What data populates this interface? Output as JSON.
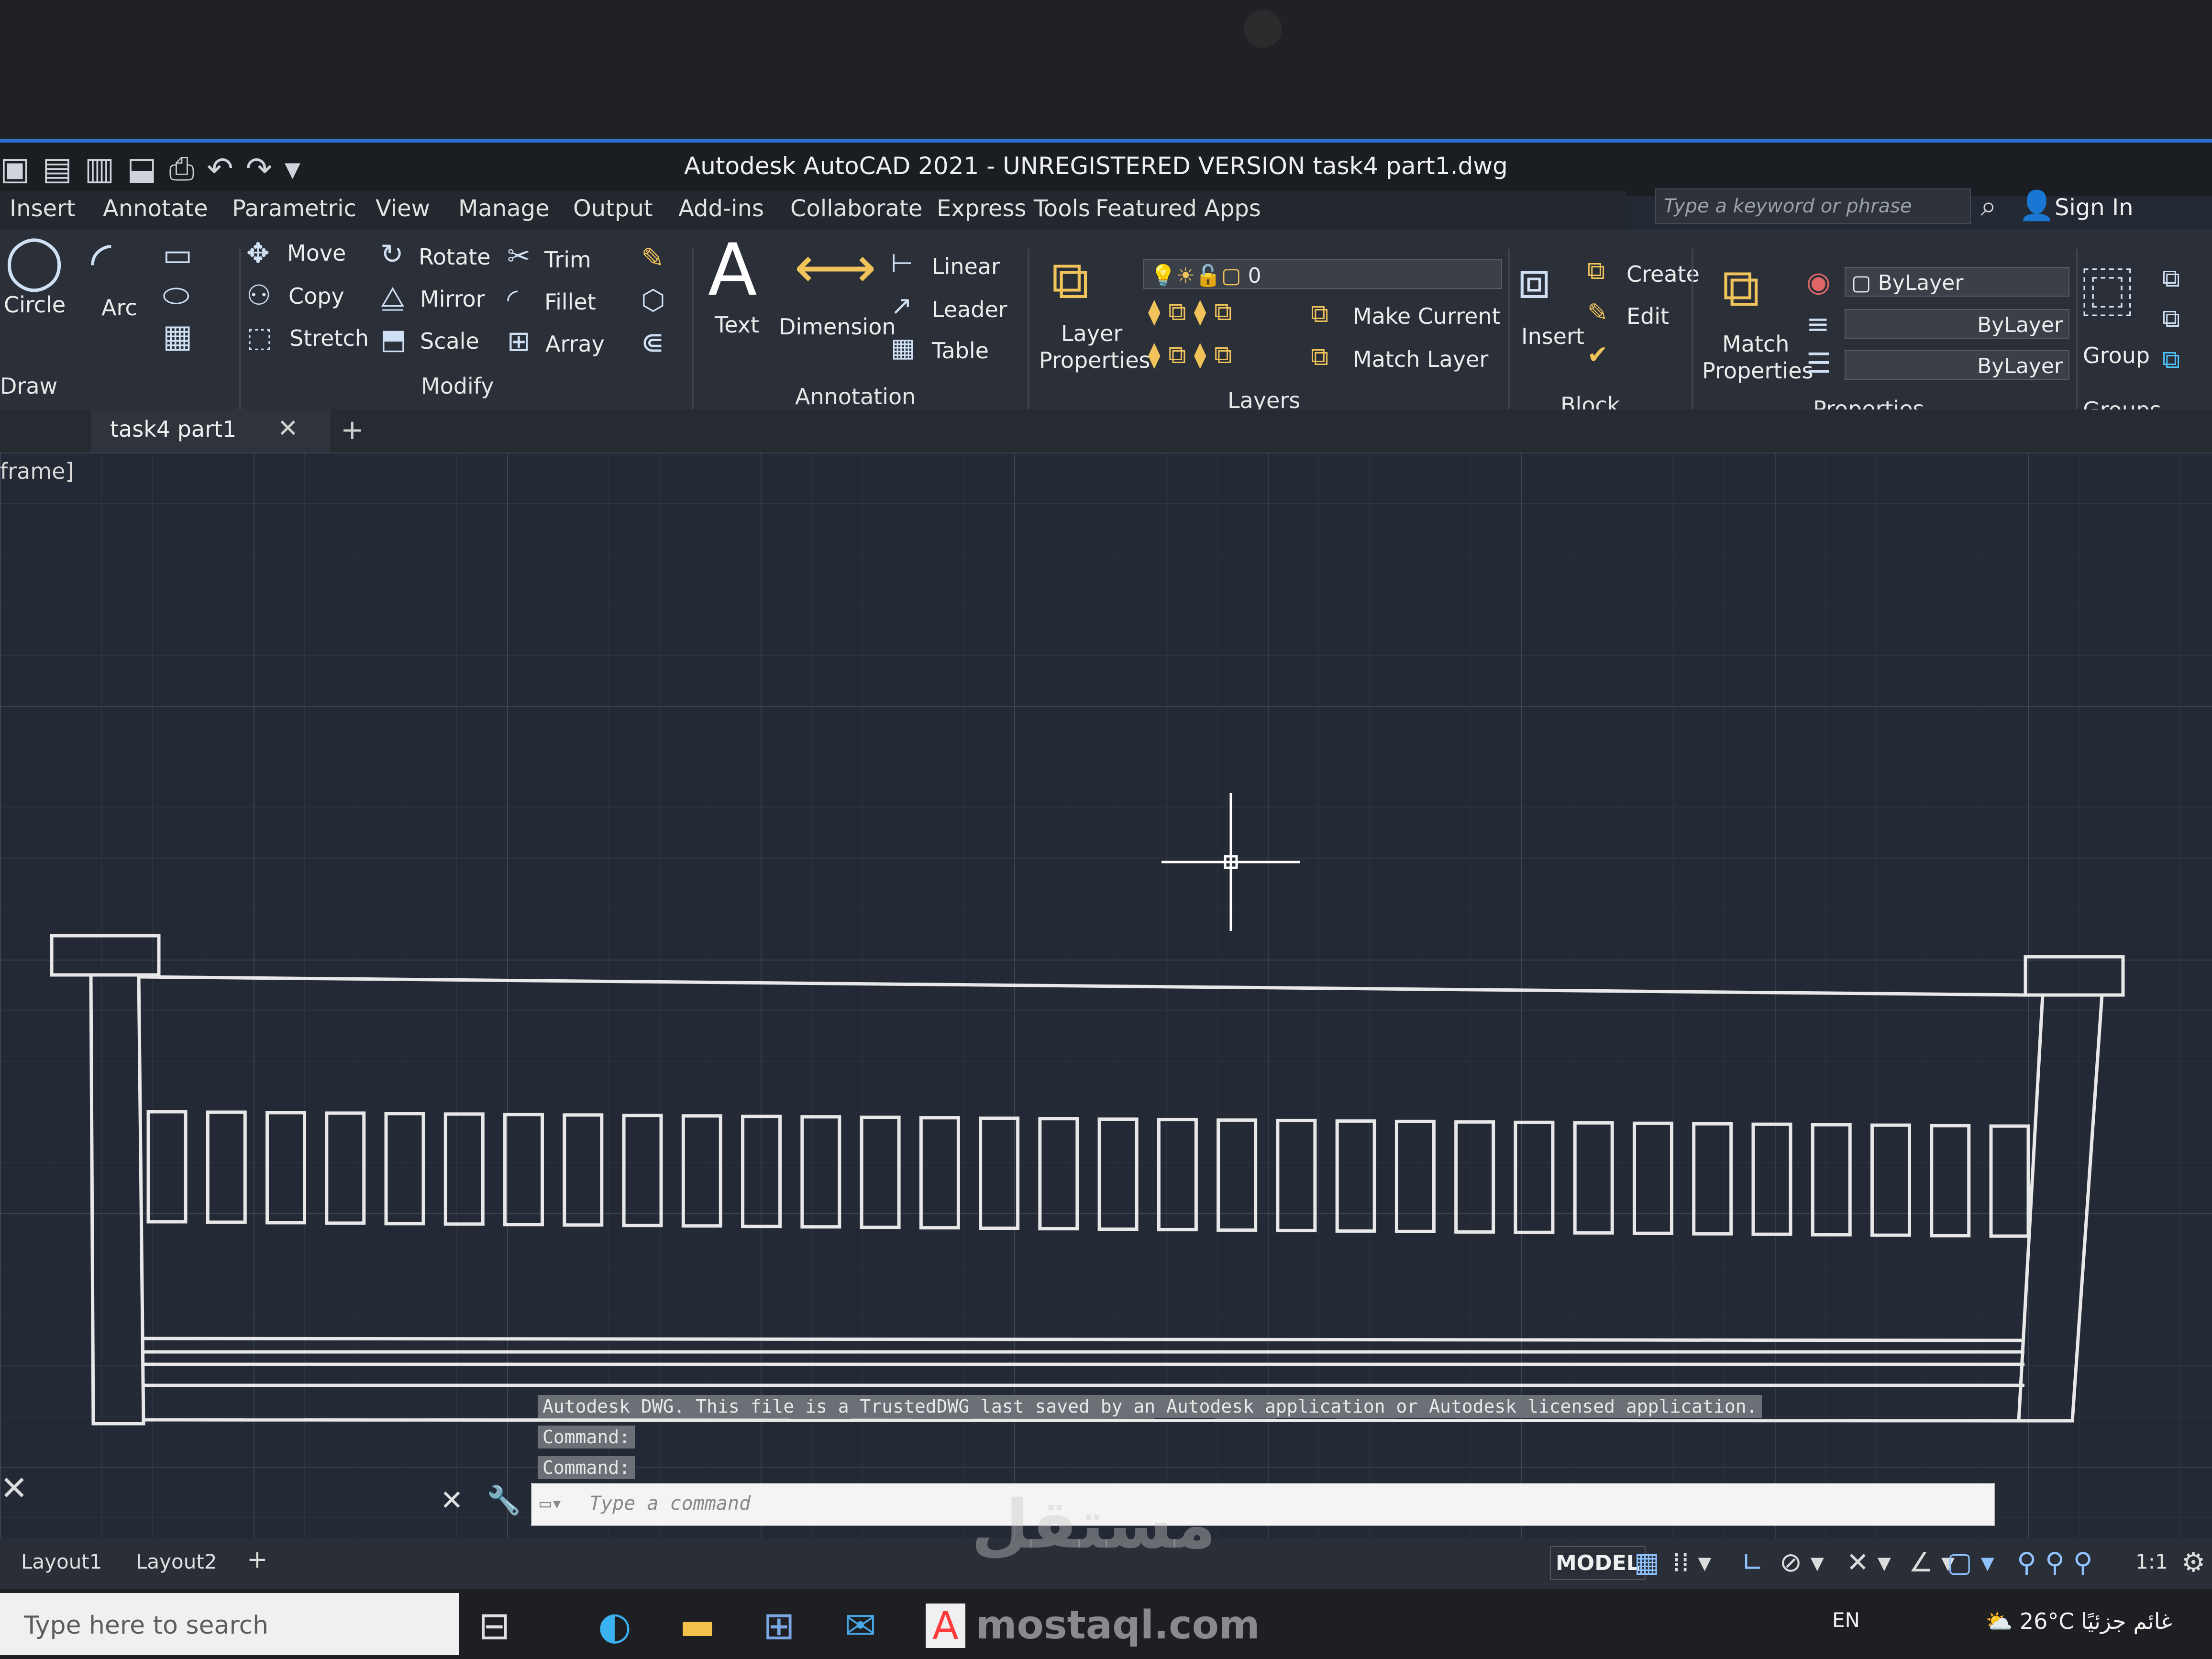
{
  "titlebar": {
    "title": "Autodesk AutoCAD 2021 - UNREGISTERED VERSION    task4 part1.dwg",
    "search_placeholder": "Type a keyword or phrase",
    "sign_in": "Sign In"
  },
  "menu_tabs": [
    "Insert",
    "Annotate",
    "Parametric",
    "View",
    "Manage",
    "Output",
    "Add-ins",
    "Collaborate",
    "Express Tools",
    "Featured Apps"
  ],
  "ribbon": {
    "draw": {
      "circle": "Circle",
      "arc": "Arc",
      "title": "Draw"
    },
    "modify": {
      "move": "Move",
      "rotate": "Rotate",
      "trim": "Trim",
      "copy": "Copy",
      "mirror": "Mirror",
      "fillet": "Fillet",
      "stretch": "Stretch",
      "scale": "Scale",
      "array": "Array",
      "title": "Modify"
    },
    "annotation": {
      "text": "Text",
      "dimension": "Dimension",
      "linear": "Linear",
      "leader": "Leader",
      "table": "Table",
      "title": "Annotation"
    },
    "layers": {
      "layer_properties_1": "Layer",
      "layer_properties_2": "Properties",
      "current_layer": "0",
      "make_current": "Make Current",
      "match_layer": "Match Layer",
      "title": "Layers"
    },
    "block": {
      "insert": "Insert",
      "create": "Create",
      "edit": "Edit",
      "title": "Block"
    },
    "properties": {
      "match_1": "Match",
      "match_2": "Properties",
      "color": "ByLayer",
      "lineweight": "ByLayer",
      "linetype": "ByLayer",
      "title": "Properties"
    },
    "groups": {
      "group": "Group",
      "title": "Groups"
    }
  },
  "file_tab": {
    "name": "task4 part1"
  },
  "viewport": {
    "label": "frame]"
  },
  "command": {
    "history": [
      "Autodesk DWG.  This file is a TrustedDWG last saved by an Autodesk application or Autodesk licensed application.",
      "Command:",
      "Command:"
    ],
    "placeholder": "Type a command"
  },
  "layouts": [
    "Layout1",
    "Layout2"
  ],
  "status": {
    "model": "MODEL",
    "scale": "1:1"
  },
  "taskbar": {
    "search": "Type here to search",
    "lang": "EN",
    "weather": "26°C",
    "weather_text": "غائم جزئيًا"
  },
  "watermark": {
    "arabic": "مستقل",
    "latin": "mostaql.com"
  },
  "drawing": {
    "balusters": 32
  }
}
